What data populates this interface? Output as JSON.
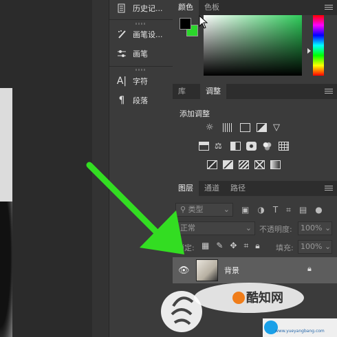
{
  "mid_panel": {
    "items": [
      {
        "label": "历史记...",
        "icon": "history-icon"
      },
      {
        "label": "画笔设...",
        "icon": "brush-settings-icon"
      },
      {
        "label": "画笔",
        "icon": "brush-presets-icon"
      },
      {
        "label": "字符",
        "icon": "character-icon"
      },
      {
        "label": "段落",
        "icon": "paragraph-icon"
      }
    ]
  },
  "color_panel": {
    "tabs": [
      "颜色",
      "色板"
    ],
    "foreground_color": "#000000",
    "background_color": "#2bd62b"
  },
  "adjust_panel": {
    "tabs": [
      "库",
      "调整"
    ],
    "title": "添加调整"
  },
  "layers_panel": {
    "tabs": [
      "图层",
      "通道",
      "路径"
    ],
    "filter_kind": "类型",
    "blend_mode": "正常",
    "opacity_label": "不透明度:",
    "opacity_value": "100%",
    "lock_label": "锁定:",
    "fill_label": "填充:",
    "fill_value": "100%",
    "layers": [
      {
        "name": "背景"
      }
    ]
  },
  "watermarks": {
    "site1": "酷知网",
    "site2_url": "www.yueyangbang.com"
  },
  "colors": {
    "arrow": "#33dd22"
  }
}
